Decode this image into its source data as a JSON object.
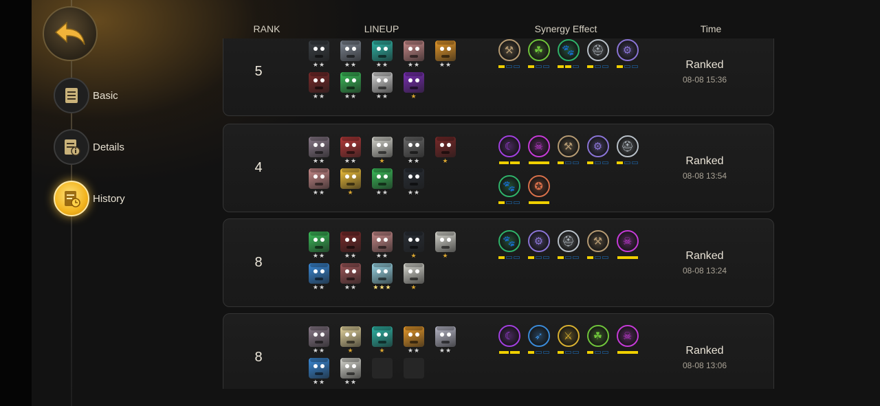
{
  "nav": {
    "back_icon": "back-arrow-icon",
    "items": [
      {
        "label": "Basic",
        "icon": "document-icon",
        "active": false
      },
      {
        "label": "Details",
        "icon": "document-info-icon",
        "active": false
      },
      {
        "label": "History",
        "icon": "history-clock-icon",
        "active": true
      }
    ]
  },
  "header": {
    "rank": "RANK",
    "lineup": "LINEUP",
    "synergy": "Synergy Effect",
    "time": "Time"
  },
  "matches": [
    {
      "rank": "5",
      "mode": "Ranked",
      "date": "08-08 15:36",
      "lineup": [
        {
          "color": "#3a3f44",
          "stars": 2
        },
        {
          "color": "#7d8592",
          "stars": 2
        },
        {
          "color": "#2fb7a8",
          "stars": 2
        },
        {
          "color": "#c88a8a",
          "stars": 2
        },
        {
          "color": "#e89a2a",
          "stars": 2
        },
        {
          "color": "#7a2a2a",
          "stars": 2
        },
        {
          "color": "#3bbf5a",
          "stars": 2
        },
        {
          "color": "#d9d9d9",
          "stars": 2
        },
        {
          "color": "#7a2fb5",
          "stars": 1
        }
      ],
      "synergy": [
        {
          "icon": "axe-icon",
          "color": "#b59a72",
          "bars": [
            1,
            0,
            0
          ]
        },
        {
          "icon": "trinity-icon",
          "color": "#6fc43a",
          "bars": [
            1,
            0,
            0
          ]
        },
        {
          "icon": "paw-icon",
          "color": "#2fb36a",
          "bars": [
            1,
            1,
            0
          ]
        },
        {
          "icon": "helmet-icon",
          "color": "#b8c0c8",
          "bars": [
            1,
            0,
            0
          ]
        },
        {
          "icon": "mech-icon",
          "color": "#8a74d6",
          "bars": [
            1,
            0,
            0
          ]
        }
      ]
    },
    {
      "rank": "4",
      "mode": "Ranked",
      "date": "08-08 13:54",
      "lineup": [
        {
          "color": "#8a7a8a",
          "stars": 2
        },
        {
          "color": "#b83a3a",
          "stars": 2
        },
        {
          "color": "#d8d8d0",
          "stars": 1
        },
        {
          "color": "#6a6a6a",
          "stars": 2
        },
        {
          "color": "#7a2a2a",
          "stars": 1
        },
        {
          "color": "#c88a8a",
          "stars": 2
        },
        {
          "color": "#f2c23a",
          "stars": 1
        },
        {
          "color": "#3bbf5a",
          "stars": 2
        },
        {
          "color": "#2a2f36",
          "stars": 2
        }
      ],
      "synergy": [
        {
          "icon": "moon-icon",
          "color": "#a23fe0",
          "bars": [
            1,
            1
          ]
        },
        {
          "icon": "demon-icon",
          "color": "#c63ad8",
          "bars": [
            1
          ]
        },
        {
          "icon": "axe-icon",
          "color": "#b59a72",
          "bars": [
            1,
            0,
            0
          ]
        },
        {
          "icon": "mech-icon",
          "color": "#8a74d6",
          "bars": [
            1,
            0,
            0
          ]
        },
        {
          "icon": "helmet-icon",
          "color": "#b8c0c8",
          "bars": [
            1,
            0,
            0
          ]
        },
        {
          "icon": "paw-icon",
          "color": "#2fb36a",
          "bars": [
            1,
            0,
            0
          ]
        },
        {
          "icon": "beast-icon",
          "color": "#d8704a",
          "bars": [
            1
          ]
        }
      ]
    },
    {
      "rank": "8",
      "mode": "Ranked",
      "date": "08-08 13:24",
      "lineup": [
        {
          "color": "#3bbf5a",
          "stars": 2
        },
        {
          "color": "#7a2a2a",
          "stars": 2
        },
        {
          "color": "#c88a8a",
          "stars": 2
        },
        {
          "color": "#2a2f36",
          "stars": 1
        },
        {
          "color": "#d8d8d0",
          "stars": 1
        },
        {
          "color": "#3a8ad8",
          "stars": 2
        },
        {
          "color": "#a0585a",
          "stars": 2
        },
        {
          "color": "#9ad8e8",
          "stars": 3
        },
        {
          "color": "#d8d8d0",
          "stars": 1
        }
      ],
      "synergy": [
        {
          "icon": "paw-icon",
          "color": "#2fb36a",
          "bars": [
            1,
            0,
            0
          ]
        },
        {
          "icon": "mech-icon",
          "color": "#8a74d6",
          "bars": [
            1,
            0,
            0
          ]
        },
        {
          "icon": "helmet-icon",
          "color": "#b8c0c8",
          "bars": [
            1,
            0,
            0
          ]
        },
        {
          "icon": "axe-icon",
          "color": "#b59a72",
          "bars": [
            1,
            0,
            0
          ]
        },
        {
          "icon": "demon-icon",
          "color": "#c63ad8",
          "bars": [
            1
          ]
        }
      ]
    },
    {
      "rank": "8",
      "mode": "Ranked",
      "date": "08-08 13:06",
      "lineup": [
        {
          "color": "#8a7a8a",
          "stars": 2
        },
        {
          "color": "#e8d8a0",
          "stars": 1
        },
        {
          "color": "#2fb7a8",
          "stars": 1
        },
        {
          "color": "#e89a2a",
          "stars": 2
        },
        {
          "color": "#b8b8c8",
          "stars": 2
        },
        {
          "color": "#3a8ad8",
          "stars": 2
        },
        {
          "color": "#d8d8d0",
          "stars": 2
        },
        {
          "color": "",
          "stars": 0
        },
        {
          "color": "",
          "stars": 0
        }
      ],
      "synergy": [
        {
          "icon": "moon-icon",
          "color": "#a23fe0",
          "bars": [
            1,
            1
          ]
        },
        {
          "icon": "feather-icon",
          "color": "#3a8ad8",
          "bars": [
            1,
            0,
            0
          ]
        },
        {
          "icon": "spear-icon",
          "color": "#d8b030",
          "bars": [
            1,
            0,
            0
          ]
        },
        {
          "icon": "trinity-icon",
          "color": "#6fc43a",
          "bars": [
            1,
            0,
            0
          ]
        },
        {
          "icon": "demon-icon",
          "color": "#c63ad8",
          "bars": [
            1
          ]
        }
      ]
    }
  ]
}
